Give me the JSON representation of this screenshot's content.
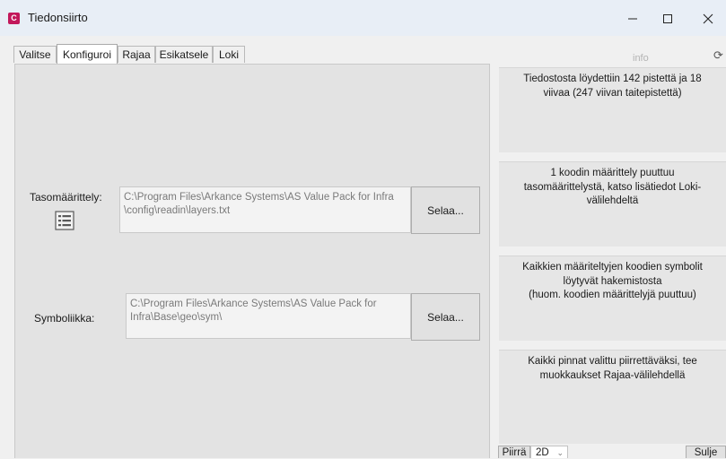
{
  "window": {
    "title": "Tiedonsiirto",
    "app_icon_letter": "C"
  },
  "tabs": [
    {
      "label": "Valitse",
      "active": false
    },
    {
      "label": "Konfiguroi",
      "active": true
    },
    {
      "label": "Rajaa",
      "active": false
    },
    {
      "label": "Esikatsele",
      "active": false
    },
    {
      "label": "Loki",
      "active": false
    }
  ],
  "config": {
    "layer_label": "Tasomäärittely:",
    "layer_path_line1": "C:\\Program Files\\Arkance Systems\\AS Value Pack for Infra",
    "layer_path_line2": "\\config\\readin\\layers.txt",
    "symbol_label": "Symboliikka:",
    "symbol_path_line1": "C:\\Program Files\\Arkance Systems\\AS Value Pack for",
    "symbol_path_line2": "Infra\\Base\\geo\\sym\\",
    "browse_label": "Selaa..."
  },
  "info": {
    "header": "info",
    "messages": [
      [
        "Tiedostosta löydettiin 142 pistettä ja 18",
        "viivaa (247 viivan taitepistettä)"
      ],
      [
        "1 koodin määrittely puuttuu",
        "tasomäärittelystä, katso lisätiedot Loki-",
        "välilehdeltä"
      ],
      [
        "Kaikkien määriteltyjen koodien symbolit",
        "löytyvät hakemistosta",
        "(huom. koodien määrittelyjä puuttuu)"
      ],
      [
        "Kaikki pinnat valittu piirrettäväksi, tee",
        "muokkaukset Rajaa-välilehdellä"
      ]
    ]
  },
  "bottom": {
    "draw_label": "Piirrä",
    "mode_value": "2D",
    "close_label": "Sulje"
  },
  "colors": {
    "accent_icon": "#c2185b",
    "titlebar": "#e8eef6",
    "panel": "#e3e3e3"
  }
}
